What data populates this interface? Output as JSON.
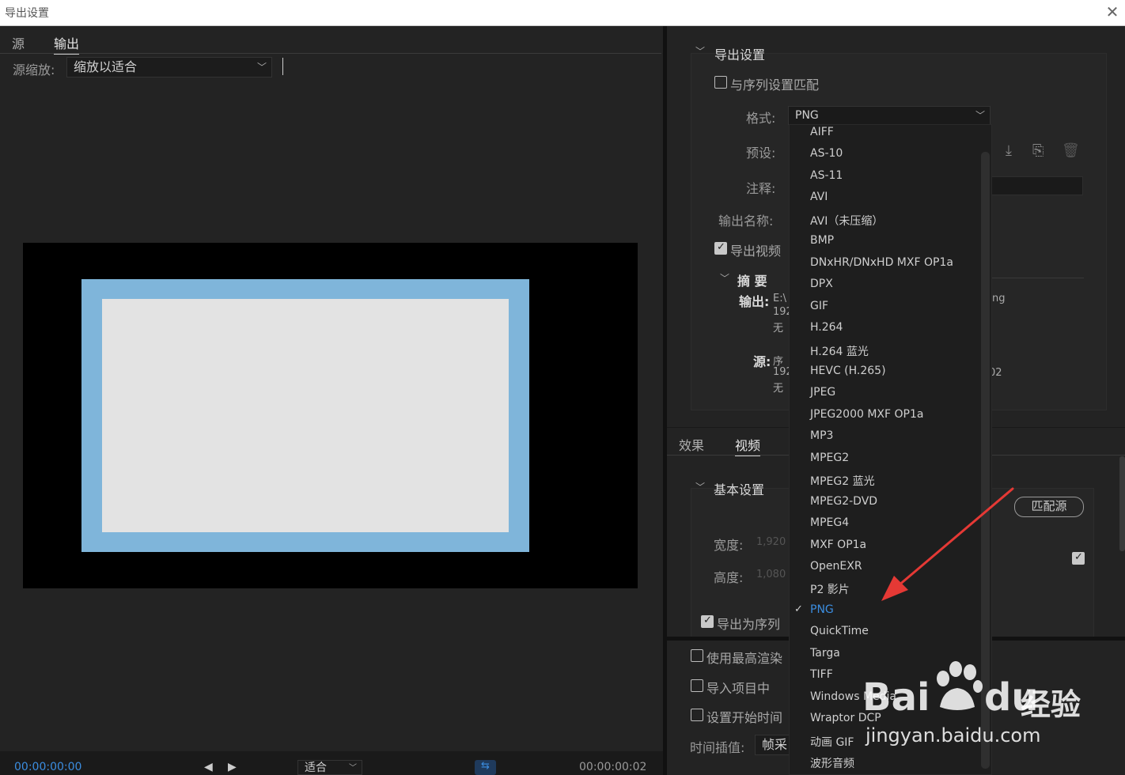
{
  "window": {
    "title": "导出设置",
    "close_glyph": "✕"
  },
  "left": {
    "tabs": [
      "源",
      "输出"
    ],
    "scale_label": "源缩放:",
    "scale_value": "缩放以适合",
    "time_start": "00:00:00:00",
    "fit_value": "适合",
    "time_end": "00:00:00:02"
  },
  "right": {
    "export_settings": {
      "heading": "导出设置",
      "match_sequence": "与序列设置匹配",
      "format_label": "格式:",
      "format_value": "PNG",
      "preset_label": "预设:",
      "comment_label": "注释:",
      "output_name_label": "输出名称:",
      "export_video": "导出视频",
      "summary": {
        "heading": "摘 要",
        "output_label": "输出:",
        "output_lines": [
          "E:\\",
          "192",
          "无"
        ],
        "output_tail": "ng",
        "source_label": "源:",
        "source_lines": [
          "序",
          "192",
          "无"
        ],
        "source_tail": "02"
      }
    },
    "tabs": [
      "效果",
      "视频"
    ],
    "basic": {
      "heading": "基本设置",
      "match_source": "匹配源",
      "width_label": "宽度:",
      "width_value": "1,920",
      "height_label": "高度:",
      "height_value": "1,080",
      "export_as_sequence": "导出为序列"
    },
    "bottom": {
      "max_render": "使用最高渲染",
      "import_project": "导入项目中",
      "set_start_time": "设置开始时间",
      "interp_label": "时间插值:",
      "interp_value": "帧采"
    }
  },
  "format_menu": {
    "items": [
      "AIFF",
      "AS-10",
      "AS-11",
      "AVI",
      "AVI（未压缩）",
      "BMP",
      "DNxHR/DNxHD MXF OP1a",
      "DPX",
      "GIF",
      "H.264",
      "H.264 蓝光",
      "HEVC (H.265)",
      "JPEG",
      "JPEG2000 MXF OP1a",
      "MP3",
      "MPEG2",
      "MPEG2 蓝光",
      "MPEG2-DVD",
      "MPEG4",
      "MXF OP1a",
      "OpenEXR",
      "P2 影片",
      "PNG",
      "QuickTime",
      "Targa",
      "TIFF",
      "Windows Media",
      "Wraptor DCP",
      "动画 GIF",
      "波形音频"
    ],
    "selected_index": 22,
    "check_glyph": "✓"
  },
  "icons": {
    "import_preset": "download-icon",
    "save_preset": "save-preset-icon",
    "delete_preset": "trash-icon"
  },
  "watermark": {
    "brand": "Bai",
    "brand2": "du",
    "cn": "经验",
    "url": "jingyan.baidu.com"
  },
  "colors": {
    "accent": "#3b8de0",
    "arrow": "#e53935",
    "preview_blue": "#7fb5da"
  }
}
